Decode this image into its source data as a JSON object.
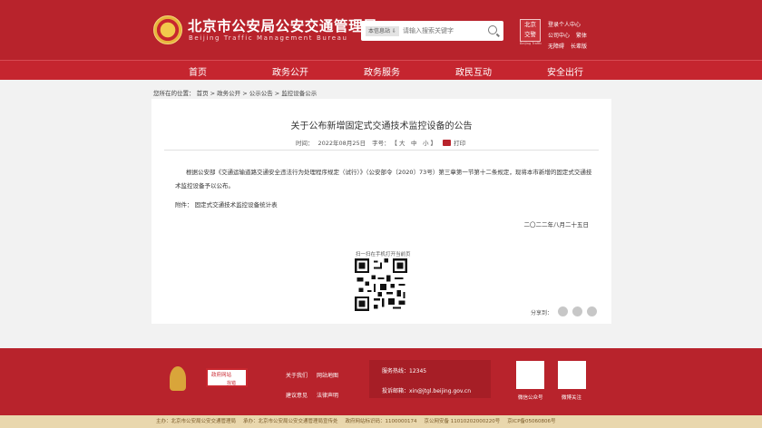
{
  "header": {
    "site_title_cn": "北京市公安局公安交通管理局",
    "site_title_en": "Beijing Traffic Management Bureau",
    "search": {
      "scope": "本信息站",
      "placeholder": "请输入搜索关键字"
    },
    "badge": {
      "line1": "北京",
      "line2": "交警",
      "sub": "Beijing Traffic"
    },
    "links": [
      "登录个人中心",
      "公司中心",
      "繁体",
      "无障碍",
      "长辈版"
    ]
  },
  "nav": [
    "首页",
    "政务公开",
    "政务服务",
    "政民互动",
    "安全出行"
  ],
  "breadcrumb": "您所在的位置： 首页 > 政务公开 > 公示公告 > 监控设备公示",
  "article": {
    "title": "关于公布新增固定式交通技术监控设备的公告",
    "time_label": "时间：",
    "time_value": "2022年08月25日",
    "font_label": "字号：",
    "font_sizes": "【 大　中　小 】",
    "print_label": "打印",
    "body_p1": "根据公安部《交通运输道路交通安全违法行为处理程序规定（试行）》（公安部令〔2020〕73号）第三章第一节第十二条规定，现将本市新增的固定式交通技术监控设备予以公布。",
    "attachment": "附件： 固定式交通技术监控设备统计表",
    "date": "二〇二二年八月二十五日",
    "qr_label": "扫一扫在手机打开当前页",
    "share_label": "分享到："
  },
  "footer": {
    "logo2_text": "政府网站",
    "logo2_sub": "找错",
    "links": [
      "关于我们",
      "网站地图",
      "建议意见",
      "法律声明"
    ],
    "hotline_label": "服务热线：12345",
    "email_label": "投诉邮箱：xin@jtgl.beijing.gov.cn",
    "qr1_caption": "微信公众号",
    "qr2_caption": "微博关注"
  },
  "bottom_bar": [
    "主办：北京市公安局公安交通管理局",
    "承办：北京市公安局公安交通管理局宣传处",
    "政府网站标识码：1100000174",
    "京公网安备 11010202000220号",
    "京ICP备05060806号"
  ]
}
